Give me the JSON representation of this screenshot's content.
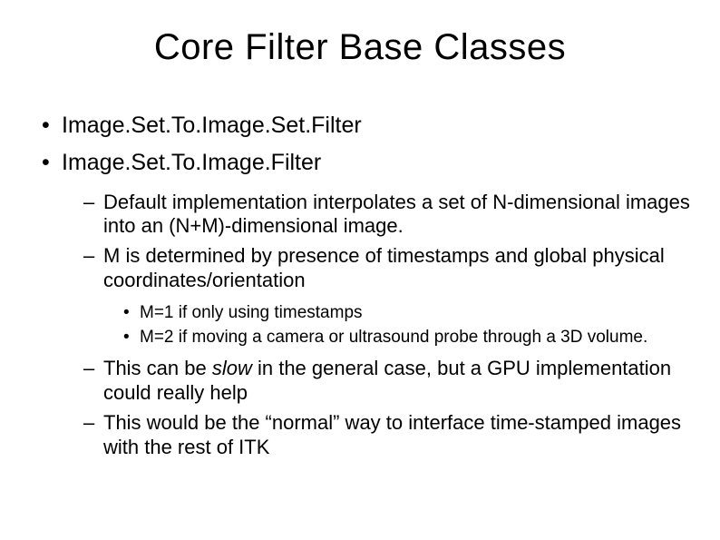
{
  "title": "Core Filter Base Classes",
  "bullets": {
    "b1": "Image.Set.To.Image.Set.Filter",
    "b2": "Image.Set.To.Image.Filter"
  },
  "sub": {
    "s1": "Default implementation interpolates a set of N-dimensional images into an (N+M)-dimensional image.",
    "s2": "M is determined by presence of timestamps and global physical coordinates/orientation",
    "s3_prefix": "This can be ",
    "s3_italic": "slow",
    "s3_suffix": " in the general case, but a GPU implementation could really help",
    "s4": "This would be the “normal” way to interface time-stamped images with the rest of ITK"
  },
  "subsub": {
    "ss1": "M=1 if only using timestamps",
    "ss2": "M=2 if moving a camera or ultrasound probe through a 3D volume."
  }
}
